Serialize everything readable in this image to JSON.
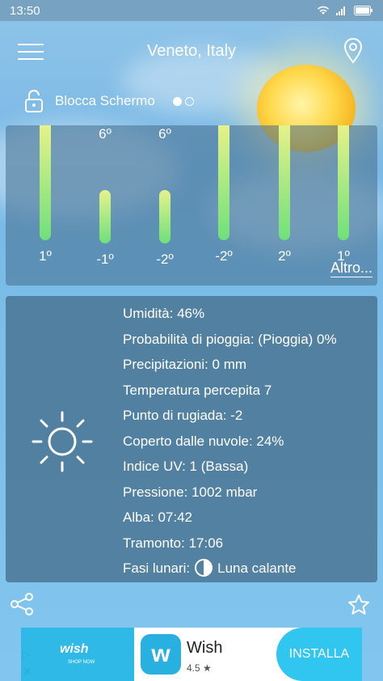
{
  "status": {
    "time": "13:50",
    "wifi_icon": "wifi-icon",
    "signal_icon": "signal-icon",
    "battery_icon": "battery-icon"
  },
  "header": {
    "title": "Veneto, Italy",
    "menu_icon": "hamburger-menu-icon",
    "location_icon": "map-pin-icon"
  },
  "lock": {
    "label": "Blocca Schermo",
    "icon": "unlock-icon"
  },
  "pager": {
    "count": 2,
    "active": 0
  },
  "forecast": {
    "bars": [
      {
        "top": "",
        "bottom": "1º",
        "fill": 1.0
      },
      {
        "top": "6º",
        "bottom": "-1º",
        "fill": 0.55
      },
      {
        "top": "6º",
        "bottom": "-2º",
        "fill": 0.55
      },
      {
        "top": "",
        "bottom": "-2º",
        "fill": 1.0
      },
      {
        "top": "",
        "bottom": "2º",
        "fill": 1.0
      },
      {
        "top": "",
        "bottom": "1º",
        "fill": 1.0
      }
    ],
    "more_label": "Altro..."
  },
  "details": {
    "weather_icon": "sun-icon",
    "rows": [
      "Umidità: 46%",
      "Probabilità di pioggia: (Pioggia) 0%",
      "Precipitazioni: 0 mm",
      "Temperatura percepita  7",
      "Punto di rugiada: -2",
      "Coperto dalle nuvole: 24%",
      "Indice UV: 1 (Bassa)",
      "Pressione: 1002 mbar",
      "Alba: 07:42",
      "Tramonto: 17:06"
    ],
    "moon_label": "Fasi lunari:",
    "moon_value": "Luna calante"
  },
  "actions": {
    "share_icon": "share-icon",
    "favorite_icon": "star-icon"
  },
  "ad": {
    "banner_brand": "wish",
    "banner_sub": "SHOP NOW",
    "app_name": "Wish",
    "app_icon_letter": "w",
    "rating": "4.5 ★",
    "install_label": "INSTALLA",
    "adchoices_icon": "adchoices-icon",
    "close_icon": "close-icon"
  },
  "colors": {
    "panel": "#466e8c",
    "bar_top": "#e6f28a",
    "bar_bottom": "#6fe07a",
    "install": "#31c6f0"
  }
}
